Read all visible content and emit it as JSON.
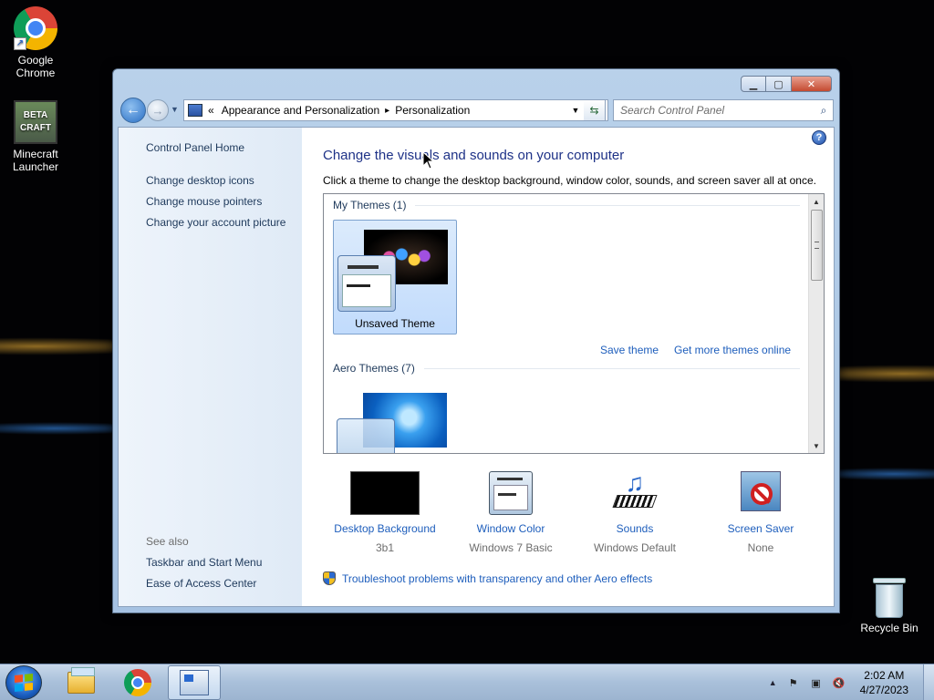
{
  "desktop": {
    "icons": [
      {
        "label": "Google Chrome"
      },
      {
        "label": "Minecraft Launcher",
        "logo_text": "BETA CRAFT"
      },
      {
        "label": "Recycle Bin"
      }
    ]
  },
  "window": {
    "controls": {
      "minimize": "▁",
      "maximize": "▢",
      "close": "✕"
    },
    "address": {
      "prefix": "«",
      "breadcrumbs": [
        "Appearance and Personalization",
        "Personalization"
      ],
      "separator": "▸"
    },
    "search": {
      "placeholder": "Search Control Panel"
    },
    "help_icon": "?",
    "sidebar": {
      "home": "Control Panel Home",
      "links": [
        "Change desktop icons",
        "Change mouse pointers",
        "Change your account picture"
      ],
      "see_also_label": "See also",
      "see_also_links": [
        "Taskbar and Start Menu",
        "Ease of Access Center"
      ]
    },
    "main": {
      "title": "Change the visuals and sounds on your computer",
      "description": "Click a theme to change the desktop background, window color, sounds, and screen saver all at once.",
      "themes": {
        "my_themes_header": "My Themes (1)",
        "selected_theme": "Unsaved Theme",
        "save_theme": "Save theme",
        "get_more": "Get more themes online",
        "aero_header": "Aero Themes (7)"
      },
      "settings": [
        {
          "title": "Desktop Background",
          "value": "3b1"
        },
        {
          "title": "Window Color",
          "value": "Windows 7 Basic"
        },
        {
          "title": "Sounds",
          "value": "Windows Default"
        },
        {
          "title": "Screen Saver",
          "value": "None"
        }
      ],
      "troubleshoot": "Troubleshoot problems with transparency and other Aero effects"
    }
  },
  "taskbar": {
    "clock": {
      "time": "2:02 AM",
      "date": "4/27/2023"
    }
  }
}
